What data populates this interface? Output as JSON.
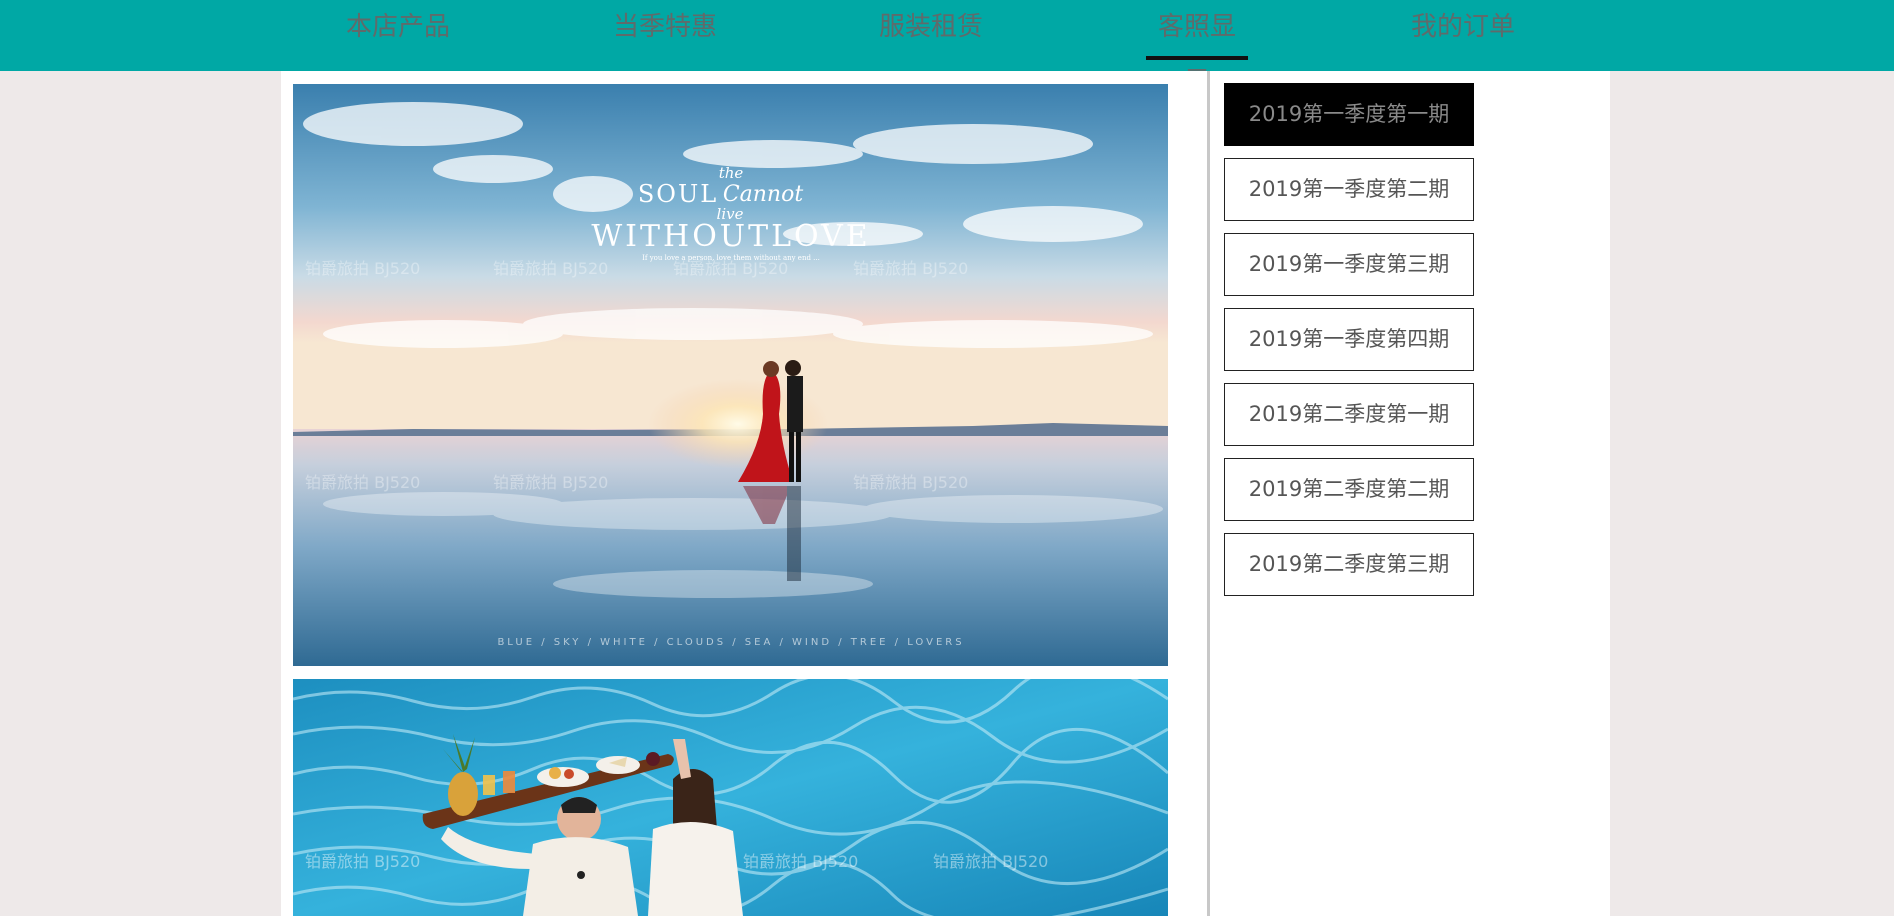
{
  "nav": {
    "items": [
      {
        "label": "本店产品"
      },
      {
        "label": "当季特惠"
      },
      {
        "label": "服装租赁"
      },
      {
        "label": "客照显示",
        "active": true
      },
      {
        "label": "我的订单"
      }
    ]
  },
  "gallery": {
    "photos": [
      {
        "title_the": "the",
        "title_soul": "SOUL",
        "title_cannot": "Cannot",
        "title_live": "live",
        "title_main": "WITHOUTLOVE",
        "tagline": "If you love a person, love them without any end ...",
        "footer": "BLUE  /  SKY  /  WHITE  /  CLOUDS  /  SEA  /  WIND  /  TREE  /  LOVERS",
        "watermark": "铂爵旅拍    BJ520"
      },
      {
        "watermark": "铂爵旅拍    BJ520"
      }
    ]
  },
  "issues": {
    "items": [
      {
        "label": "2019第一季度第一期",
        "active": true
      },
      {
        "label": "2019第一季度第二期"
      },
      {
        "label": "2019第一季度第三期"
      },
      {
        "label": "2019第一季度第四期"
      },
      {
        "label": "2019第二季度第一期"
      },
      {
        "label": "2019第二季度第二期"
      },
      {
        "label": "2019第二季度第三期"
      }
    ]
  },
  "colors": {
    "nav_bg": "#00a8a5",
    "page_bg": "#eee9e9",
    "active_issue_bg": "#000000"
  }
}
